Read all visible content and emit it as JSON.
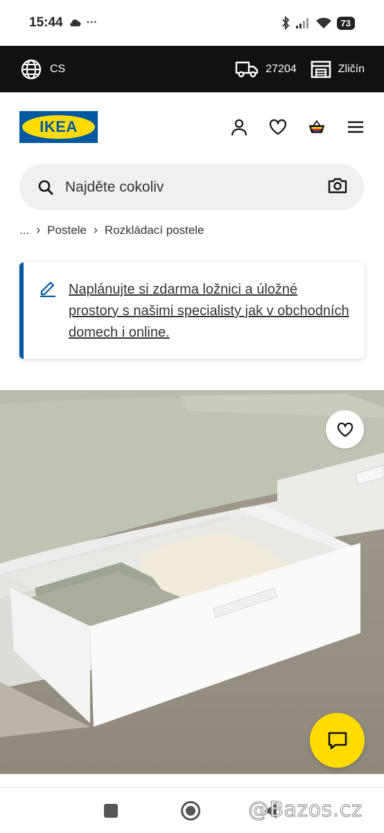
{
  "status_bar": {
    "time": "15:44",
    "dots": "···",
    "battery": "73"
  },
  "topbar": {
    "language": "CS",
    "postcode": "27204",
    "store": "Zličín"
  },
  "brand": {
    "logo_text": "IKEA",
    "colors": {
      "blue": "#0058a3",
      "yellow": "#ffdb00",
      "topbar": "#111111"
    }
  },
  "header_icons": [
    "user-icon",
    "heart-icon",
    "basket-icon",
    "menu-icon"
  ],
  "search": {
    "placeholder": "Najděte cokoliv"
  },
  "breadcrumb": {
    "ellipsis": "...",
    "items": [
      "Postele",
      "Rozkládací postele"
    ]
  },
  "promo": {
    "text": "Naplánujte si zdarma ložnici a úložné prostory s našimi specialisty jak v obchodních domech i online."
  },
  "watermark": "@Bazos.cz"
}
